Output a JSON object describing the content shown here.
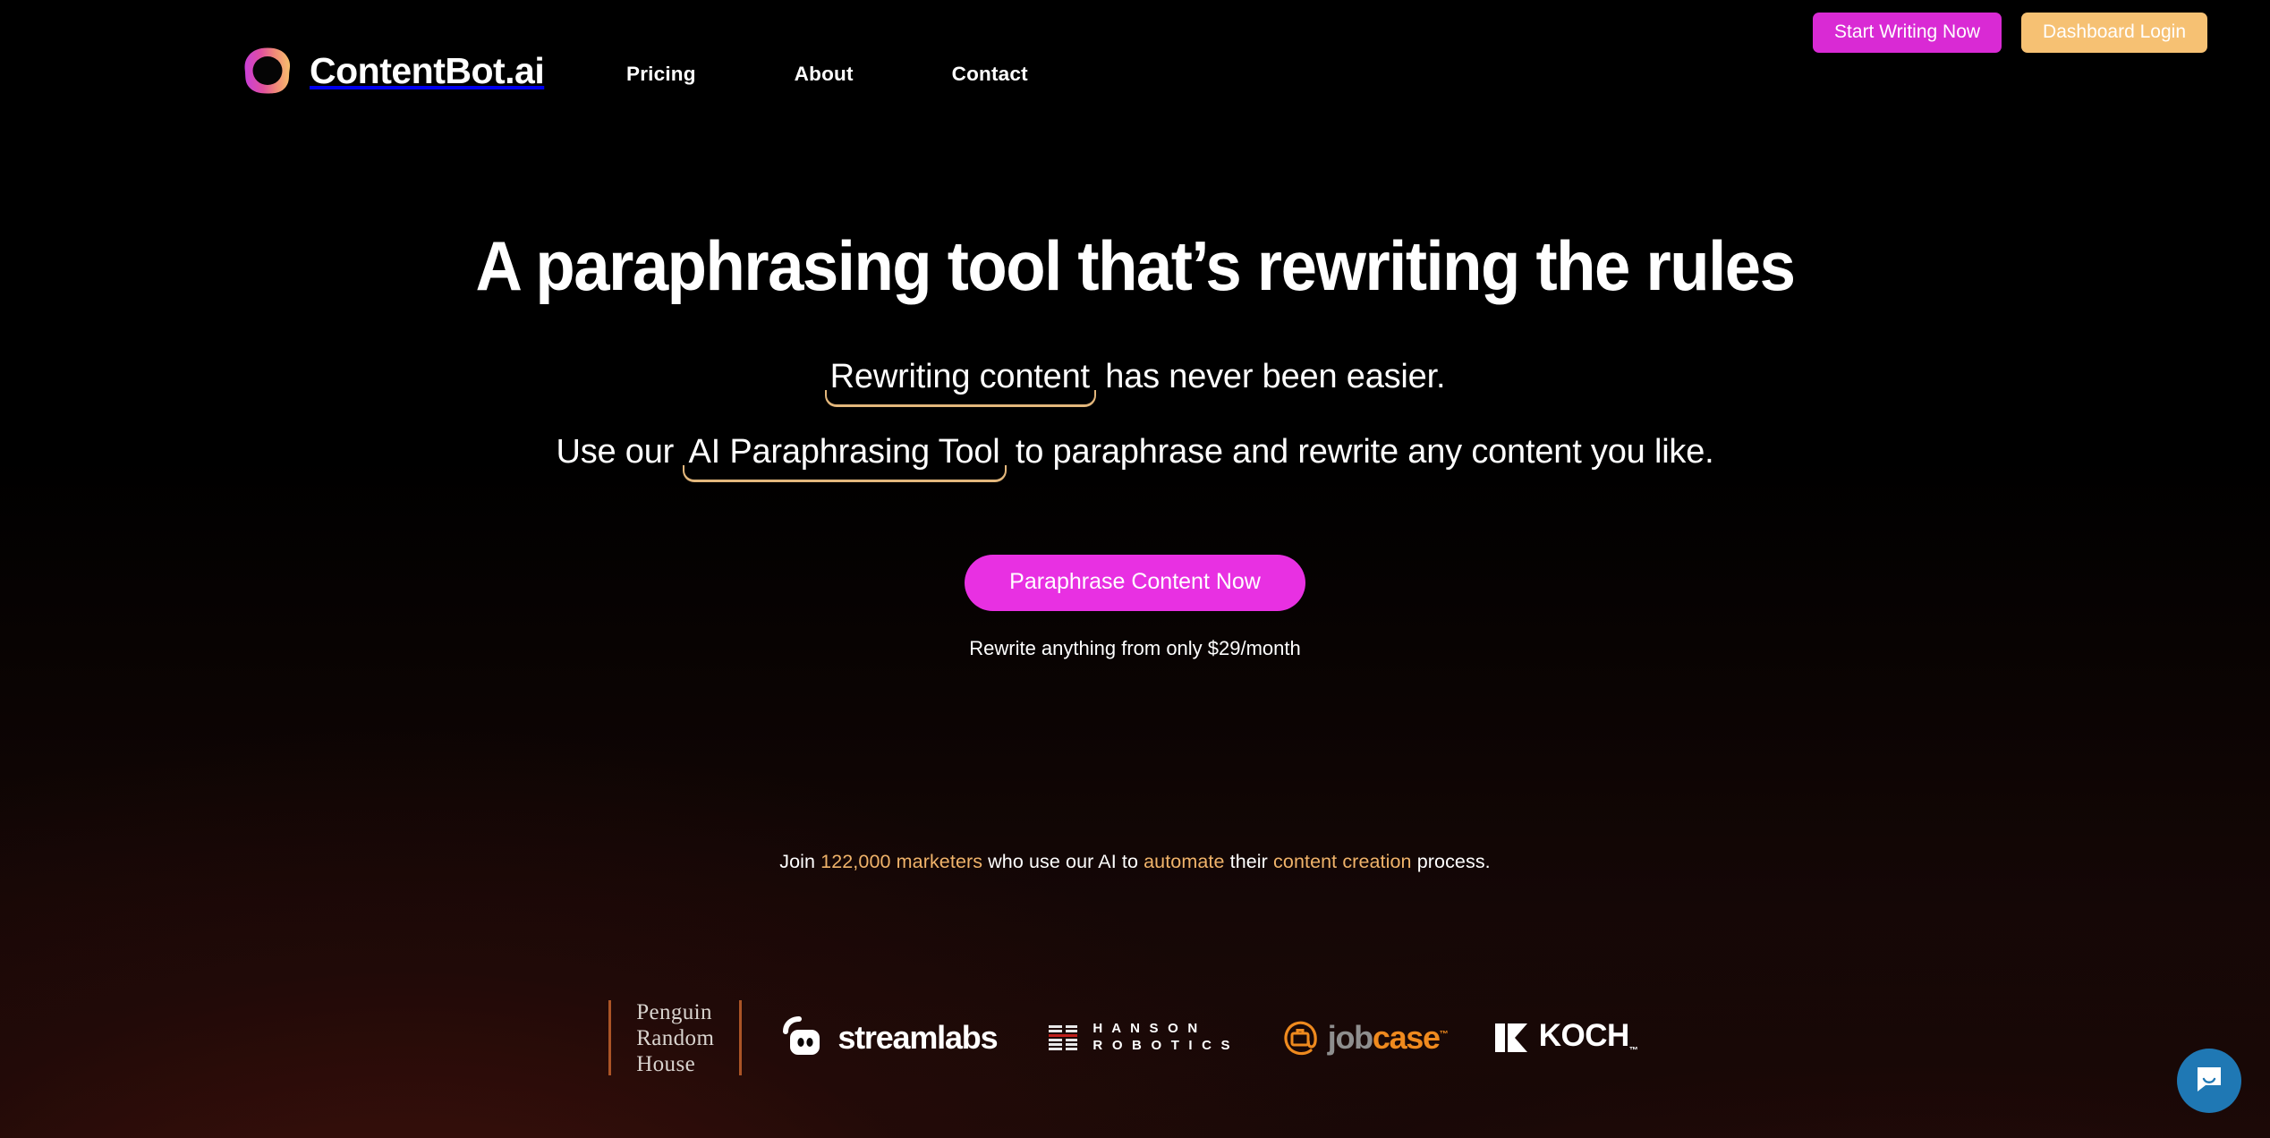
{
  "brand": {
    "name": "ContentBot.ai",
    "logo_icon": "contentbot-ring-logo",
    "gradient_from": "#d63fd0",
    "gradient_to": "#f5b96b"
  },
  "nav": {
    "links": [
      {
        "label": "Pricing"
      },
      {
        "label": "About"
      },
      {
        "label": "Contact"
      }
    ]
  },
  "header_actions": {
    "start_writing_label": "Start Writing Now",
    "dashboard_login_label": "Dashboard Login",
    "start_writing_color": "#d92ad4",
    "dashboard_login_color": "#f6c173"
  },
  "hero": {
    "headline": "A paraphrasing tool that’s rewriting the rules",
    "sub1_highlight": "Rewriting content",
    "sub1_rest": " has never been easier.",
    "sub2_before": "Use our ",
    "sub2_highlight": "AI Paraphrasing Tool",
    "sub2_after": " to paraphrase and rewrite any content you like.",
    "cta_label": "Paraphrase Content Now",
    "cta_color": "#e830e2",
    "cta_note": "Rewrite anything from only $29/month",
    "underline_color": "#f0c183"
  },
  "social_proof": {
    "part1": "Join ",
    "count": "122,000 marketers",
    "part2": " who use our AI to ",
    "accent2": "automate",
    "part3": " their ",
    "accent3": "content creation",
    "part4": " process.",
    "accent_color": "#f0b36a"
  },
  "logo_strip": {
    "divider_color": "#c2622c",
    "brands": [
      {
        "name": "Penguin Random House",
        "line1": "Penguin",
        "line2": "Random",
        "line3": "House"
      },
      {
        "name": "Streamlabs",
        "text": "streamlabs"
      },
      {
        "name": "Hanson Robotics",
        "line1": "H A N S O N",
        "line2": "R O B O T I C S"
      },
      {
        "name": "Jobcase",
        "part_gray": "job",
        "part_orange": "case",
        "tm": "™"
      },
      {
        "name": "Koch",
        "text": "KOCH",
        "tm": "™"
      }
    ]
  },
  "intercom": {
    "icon": "chat-smile-icon",
    "color": "#1f78b4"
  }
}
